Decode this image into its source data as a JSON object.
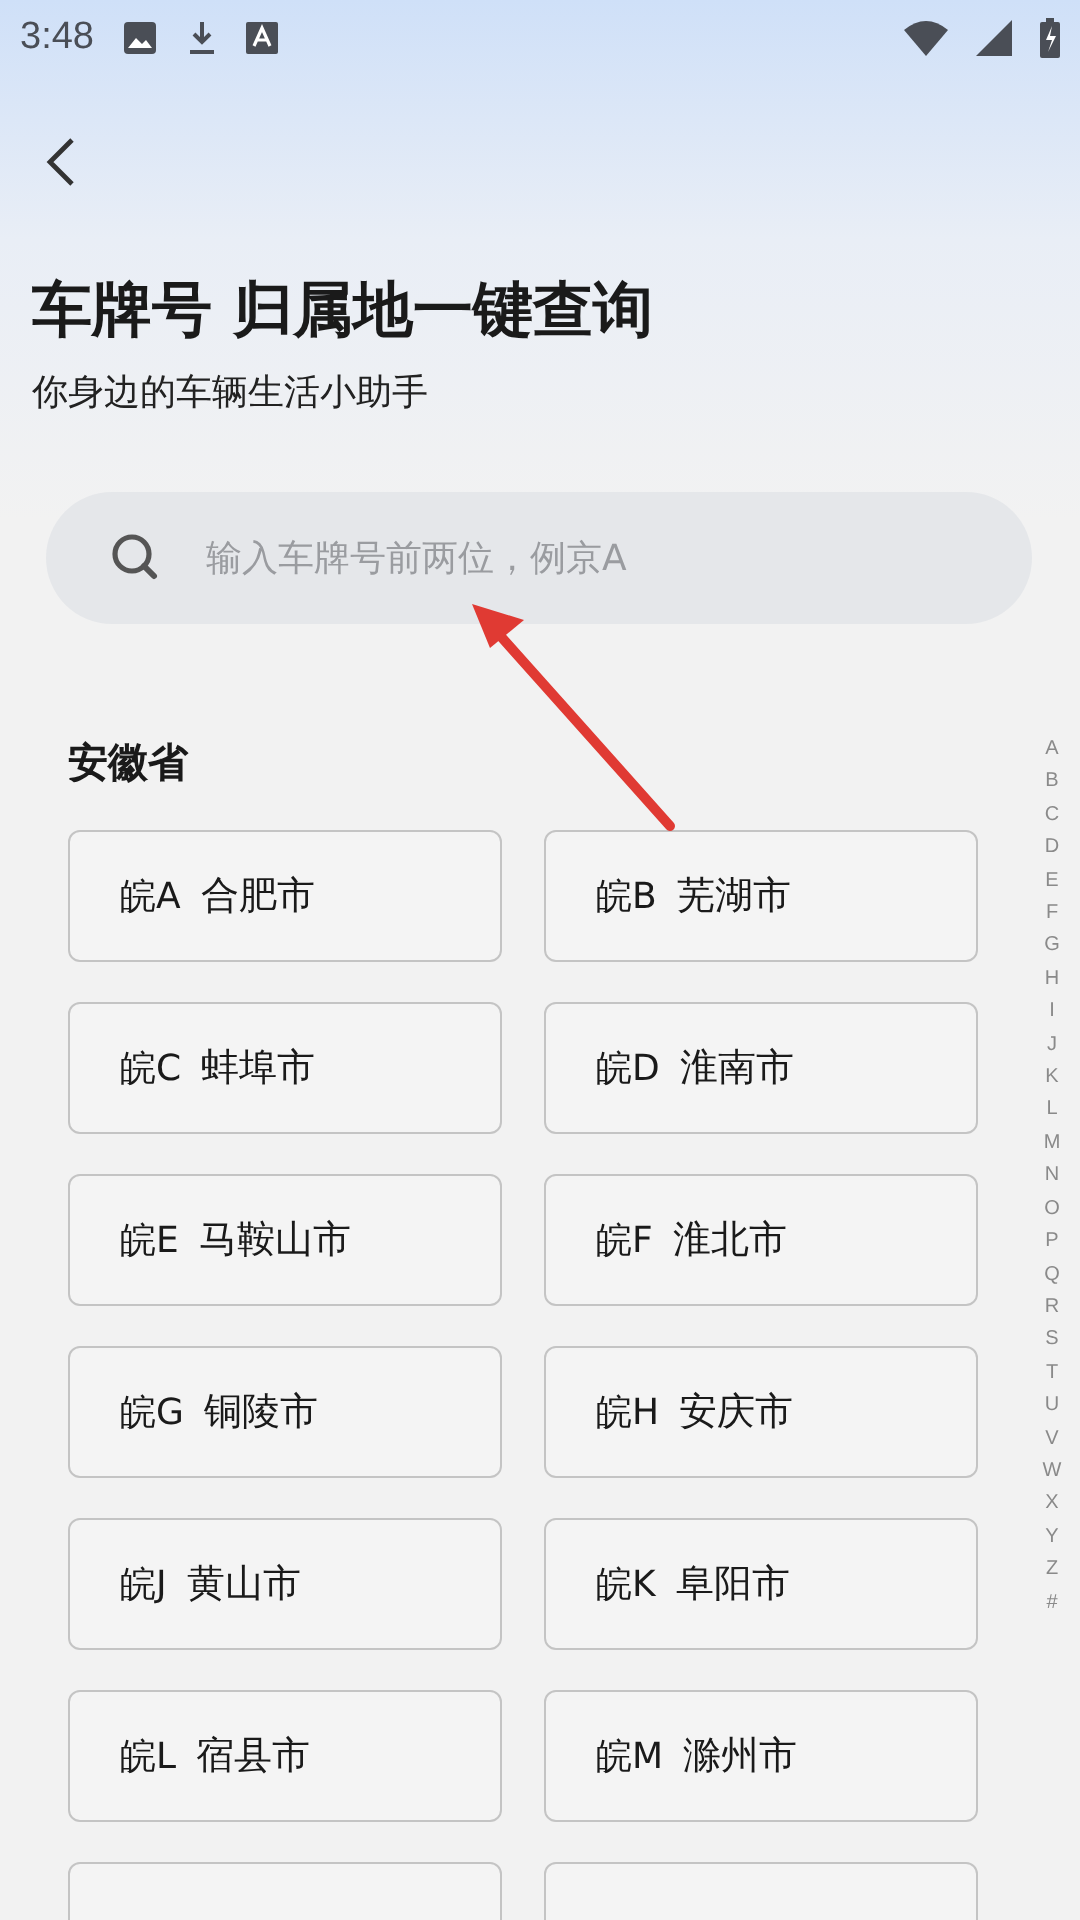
{
  "status_bar": {
    "time": "3:48"
  },
  "header": {
    "title": "车牌号 归属地一键查询",
    "subtitle": "你身边的车辆生活小助手"
  },
  "search": {
    "placeholder": "输入车牌号前两位，例京A"
  },
  "sections": [
    {
      "name": "安徽省",
      "cities": [
        {
          "plate": "皖A",
          "city": "合肥市"
        },
        {
          "plate": "皖B",
          "city": "芜湖市"
        },
        {
          "plate": "皖C",
          "city": "蚌埠市"
        },
        {
          "plate": "皖D",
          "city": "淮南市"
        },
        {
          "plate": "皖E",
          "city": "马鞍山市"
        },
        {
          "plate": "皖F",
          "city": "淮北市"
        },
        {
          "plate": "皖G",
          "city": "铜陵市"
        },
        {
          "plate": "皖H",
          "city": "安庆市"
        },
        {
          "plate": "皖J",
          "city": "黄山市"
        },
        {
          "plate": "皖K",
          "city": "阜阳市"
        },
        {
          "plate": "皖L",
          "city": "宿县市"
        },
        {
          "plate": "皖M",
          "city": "滁州市"
        }
      ]
    }
  ],
  "index": [
    "A",
    "B",
    "C",
    "D",
    "E",
    "F",
    "G",
    "H",
    "I",
    "J",
    "K",
    "L",
    "M",
    "N",
    "O",
    "P",
    "Q",
    "R",
    "S",
    "T",
    "U",
    "V",
    "W",
    "X",
    "Y",
    "Z",
    "#"
  ]
}
